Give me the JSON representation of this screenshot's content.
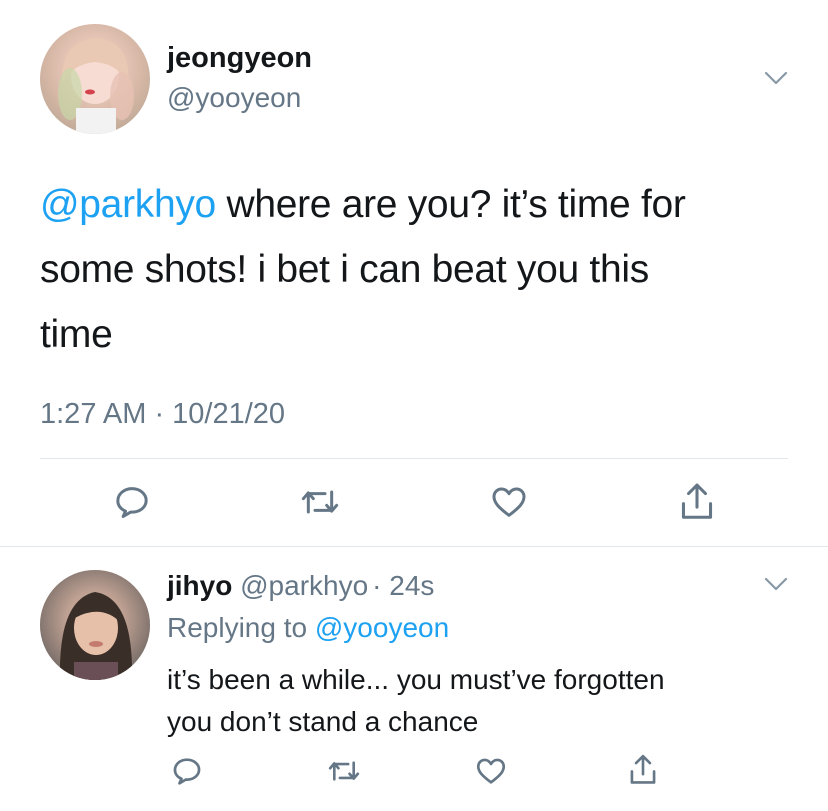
{
  "main_tweet": {
    "display_name": "jeongyeon",
    "handle": "@yooyeon",
    "mention": "@parkhyo",
    "text_line1": " where are you? it’s time for",
    "text_line2": "some shots! i bet i can beat you this",
    "text_line3": "time",
    "timestamp": "1:27 AM · 10/21/20"
  },
  "reply": {
    "display_name": "jihyo",
    "handle": "@parkhyo",
    "age": "· 24s",
    "replying_label": "Replying to ",
    "replying_to": "@yooyeon",
    "text_line1": "it’s been a while... you must’ve forgotten",
    "text_line2": "you don’t stand a chance"
  },
  "icons": [
    "chevron-down-icon",
    "reply-icon",
    "retweet-icon",
    "like-icon",
    "share-icon"
  ],
  "colors": {
    "link": "#1da1f2",
    "muted": "#657786",
    "text": "#14171a",
    "icon": "#657786"
  }
}
